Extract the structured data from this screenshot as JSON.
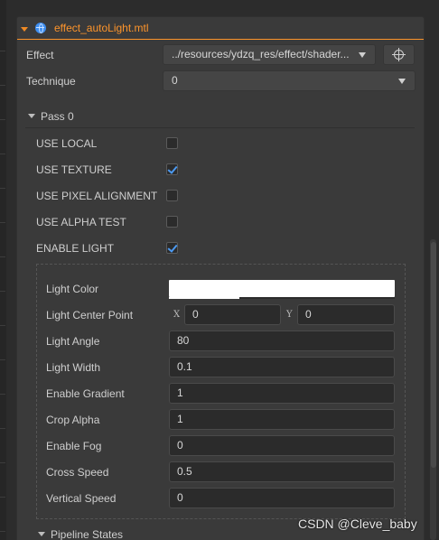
{
  "header": {
    "title": "effect_autoLight.mtl",
    "icon": "globe-icon",
    "accent": "#fd942b"
  },
  "effect": {
    "label": "Effect",
    "value": "../resources/ydzq_res/effect/shader..."
  },
  "technique": {
    "label": "Technique",
    "value": "0"
  },
  "pass": {
    "title": "Pass 0",
    "options": [
      {
        "label": "USE LOCAL",
        "checked": false
      },
      {
        "label": "USE TEXTURE",
        "checked": true
      },
      {
        "label": "USE PIXEL ALIGNMENT",
        "checked": false
      },
      {
        "label": "USE ALPHA TEST",
        "checked": false
      },
      {
        "label": "ENABLE LIGHT",
        "checked": true
      }
    ]
  },
  "light": {
    "color_label": "Light Color",
    "color_value": "#ffffff",
    "center_label": "Light Center Point",
    "center_x_axis": "X",
    "center_x": "0",
    "center_y_axis": "Y",
    "center_y": "0",
    "props": [
      {
        "label": "Light Angle",
        "value": "80"
      },
      {
        "label": "Light Width",
        "value": "0.1"
      },
      {
        "label": "Enable Gradient",
        "value": "1"
      },
      {
        "label": "Crop Alpha",
        "value": "1"
      },
      {
        "label": "Enable Fog",
        "value": "0"
      },
      {
        "label": "Cross Speed",
        "value": "0.5"
      },
      {
        "label": "Vertical Speed",
        "value": "0"
      }
    ]
  },
  "pipeline": {
    "title": "Pipeline States"
  },
  "watermark": "CSDN @Cleve_baby"
}
